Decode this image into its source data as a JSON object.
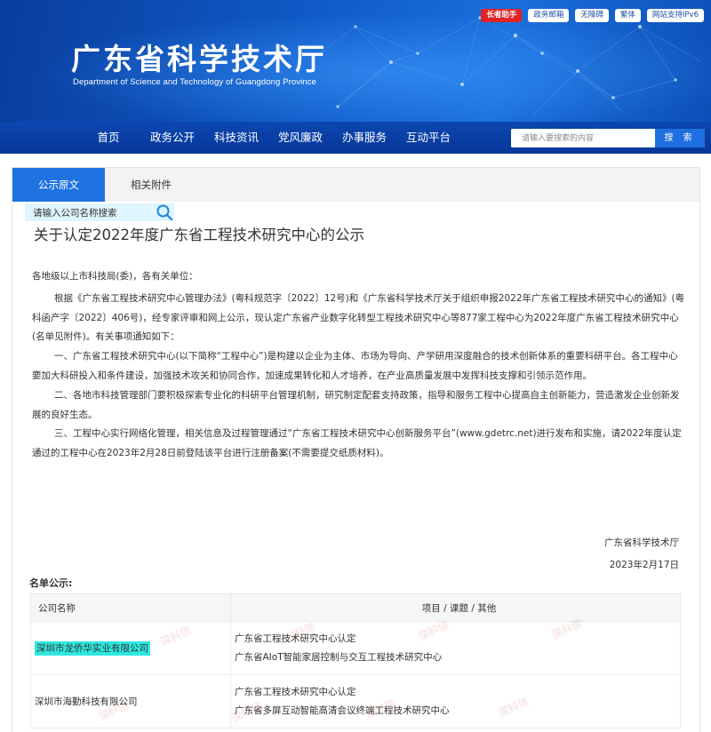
{
  "header": {
    "title": "广东省科学技术厅",
    "subtitle": "Department of Science and Technology of Guangdong Province",
    "top_links": [
      "长者助手",
      "政务邮箱",
      "无障碍",
      "繁体",
      "网站支持IPv6"
    ]
  },
  "nav": {
    "items": [
      "首页",
      "政务公开",
      "科技资讯",
      "党风廉政",
      "办事服务",
      "互动平台"
    ],
    "search_placeholder": "请输入要搜索的内容",
    "search_button": "搜 索"
  },
  "tabs": [
    "公示原文",
    "相关附件"
  ],
  "company_search_placeholder": "请输入公司名称搜索",
  "article": {
    "title": "关于认定2022年度广东省工程技术研究中心的公示",
    "salutation": "各地级以上市科技局(委)，各有关单位：",
    "paragraphs": [
      "根据《广东省工程技术研究中心管理办法》(粤科规范字〔2022〕12号)和《广东省科学技术厅关于组织申报2022年广东省工程技术研究中心的通知》(粤科函产字〔2022〕406号)，经专家评审和网上公示，现认定广东省产业数字化转型工程技术研究中心等877家工程中心为2022年度广东省工程技术研究中心(名单见附件)。有关事项通知如下：",
      "一、广东省工程技术研究中心(以下简称“工程中心”)是构建以企业为主体、市场为导向、产学研用深度融合的技术创新体系的重要科研平台。各工程中心要加大科研投入和条件建设，加强技术攻关和协同合作，加速成果转化和人才培养，在产业高质量发展中发挥科技支撑和引领示范作用。",
      "二、各地市科技管理部门要积极探索专业化的科研平台管理机制，研究制定配套支持政策，指导和服务工程中心提高自主创新能力，营造激发企业创新发展的良好生态。",
      "三、工程中心实行网络化管理，相关信息及过程管理通过“广东省工程技术研究中心创新服务平台”(www.gdetrc.net)进行发布和实施，请2022年度认定通过的工程中心在2023年2月28日前登陆该平台进行注册备案(不需要提交纸质材料)。"
    ],
    "signature_org": "广东省科学技术厅",
    "signature_date": "2023年2月17日"
  },
  "list": {
    "heading": "名单公示:",
    "col_company": "公司名称",
    "col_items": "项目 / 课题 / 其他",
    "rows": [
      {
        "company": "深圳市龙侨华实业有限公司",
        "line1": "广东省工程技术研究中心认定",
        "line2": "广东省AIoT智能家居控制与交互工程技术研究中心"
      },
      {
        "company": "深圳市海勤科技有限公司",
        "line1": "广东省工程技术研究中心认定",
        "line2": "广东省多屏互动智能高清会议终端工程技术研究中心"
      }
    ],
    "watermark": "深科信"
  },
  "colors": {
    "banner": "#0e58c4",
    "nav": "#08379a",
    "tab_active": "#1f73e0",
    "highlight": "#2ee8e0",
    "elder_button": "#e02424"
  }
}
